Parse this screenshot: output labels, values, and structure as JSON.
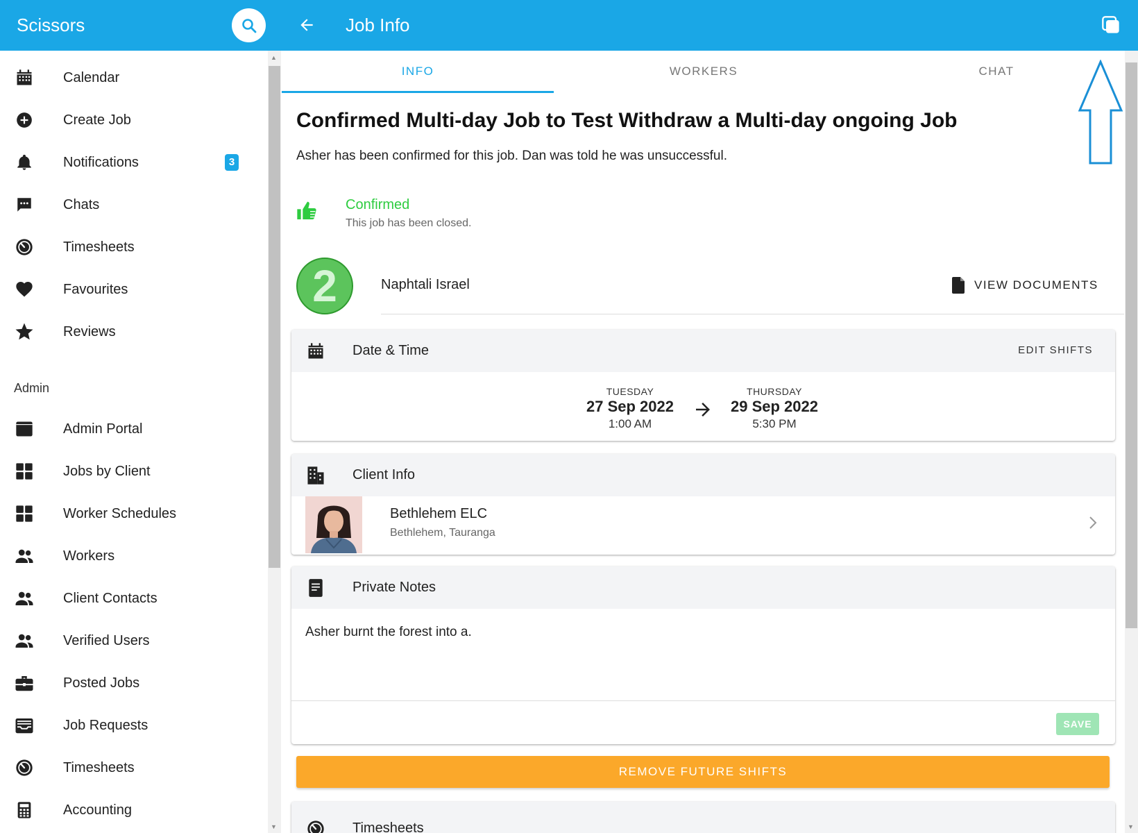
{
  "app": {
    "title": "Scissors",
    "page_title": "Job Info",
    "accent_color": "#1aa7e6"
  },
  "sidebar": {
    "items": [
      {
        "label": "Calendar",
        "icon": "calendar-icon"
      },
      {
        "label": "Create Job",
        "icon": "add-circle-icon"
      },
      {
        "label": "Notifications",
        "icon": "bell-icon",
        "badge": "3"
      },
      {
        "label": "Chats",
        "icon": "chat-icon"
      },
      {
        "label": "Timesheets",
        "icon": "timer-icon"
      },
      {
        "label": "Favourites",
        "icon": "heart-icon"
      },
      {
        "label": "Reviews",
        "icon": "star-icon"
      }
    ],
    "section_label": "Admin",
    "admin_items": [
      {
        "label": "Admin Portal",
        "icon": "window-icon"
      },
      {
        "label": "Jobs by Client",
        "icon": "grid-icon"
      },
      {
        "label": "Worker Schedules",
        "icon": "grid-icon"
      },
      {
        "label": "Workers",
        "icon": "people-icon"
      },
      {
        "label": "Client Contacts",
        "icon": "people-icon"
      },
      {
        "label": "Verified Users",
        "icon": "people-icon"
      },
      {
        "label": "Posted Jobs",
        "icon": "briefcase-icon"
      },
      {
        "label": "Job Requests",
        "icon": "inbox-icon"
      },
      {
        "label": "Timesheets",
        "icon": "timer-icon"
      },
      {
        "label": "Accounting",
        "icon": "calculator-icon"
      }
    ]
  },
  "tabs": [
    "INFO",
    "WORKERS",
    "CHAT"
  ],
  "job": {
    "title": "Confirmed Multi-day Job to Test Withdraw a Multi-day ongoing Job",
    "description": "Asher has been confirmed for this job. Dan was told he was unsuccessful.",
    "status": "Confirmed",
    "status_sub": "This job has been closed.",
    "status_color": "#2ecc40"
  },
  "worker": {
    "badge_number": "2",
    "name": "Naphtali Israel",
    "docs_label": "VIEW DOCUMENTS"
  },
  "date_time": {
    "title": "Date & Time",
    "action": "EDIT SHIFTS",
    "start": {
      "day": "TUESDAY",
      "date": "27 Sep 2022",
      "time": "1:00 AM"
    },
    "end": {
      "day": "THURSDAY",
      "date": "29 Sep 2022",
      "time": "5:30 PM"
    }
  },
  "client_info": {
    "title": "Client Info",
    "name": "Bethlehem ELC",
    "location": "Bethlehem, Tauranga"
  },
  "private_notes": {
    "title": "Private Notes",
    "text": "Asher burnt the forest into a.",
    "save_label": "SAVE"
  },
  "remove_future_shifts": {
    "label": "REMOVE FUTURE SHIFTS",
    "color": "#fba82a"
  },
  "timesheets_card": {
    "title": "Timesheets"
  }
}
